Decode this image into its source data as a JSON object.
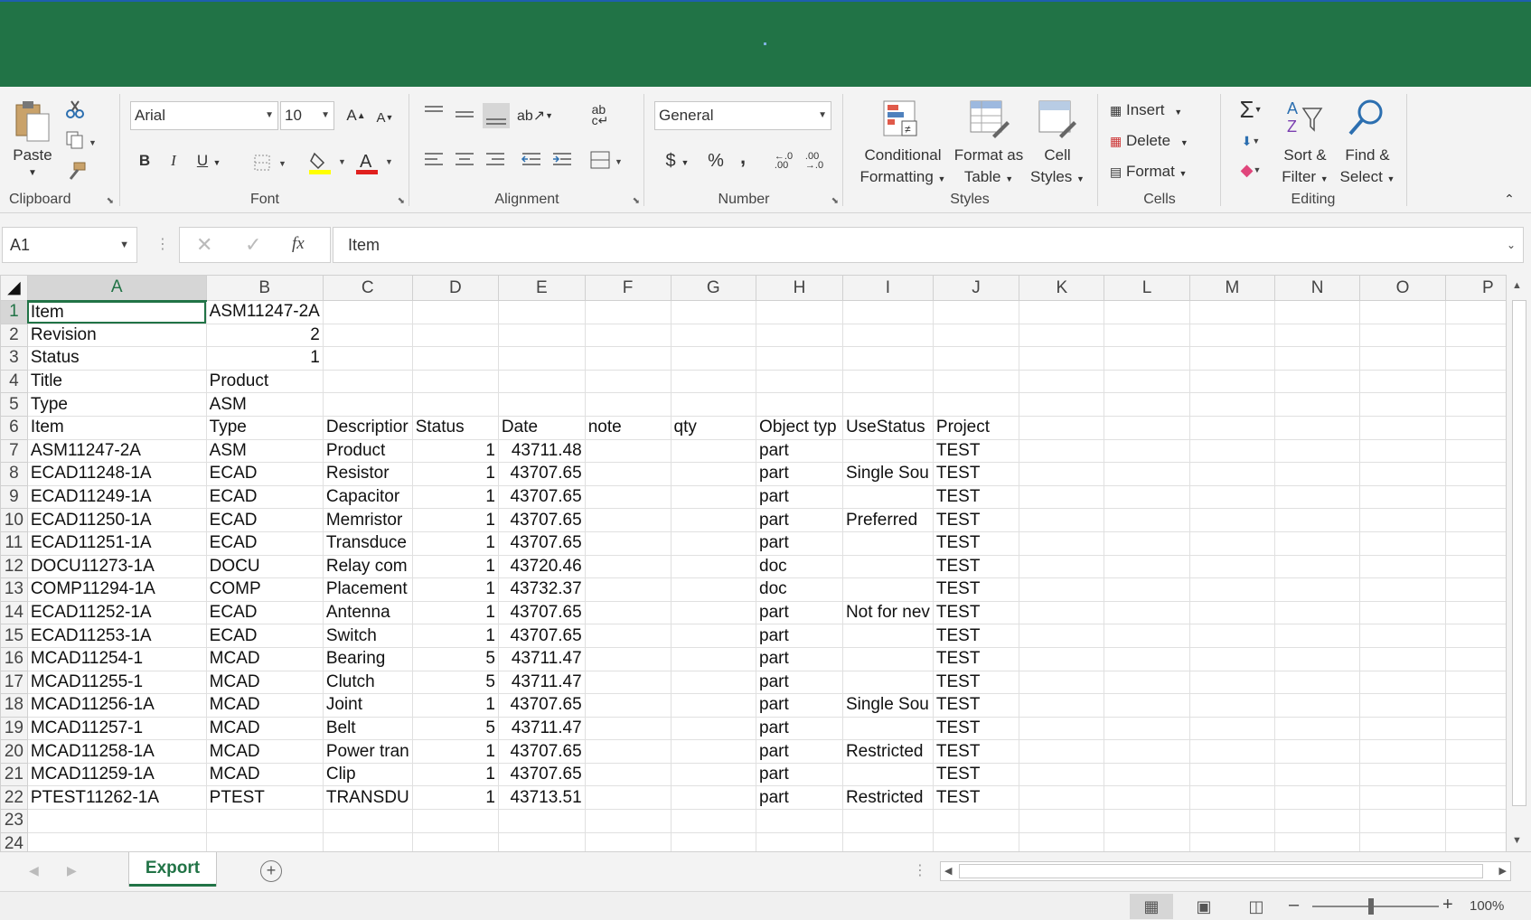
{
  "ribbon": {
    "clipboard": {
      "label": "Clipboard",
      "paste": "Paste"
    },
    "font": {
      "label": "Font",
      "font_name": "Arial",
      "font_size": "10",
      "bold": "B",
      "italic": "I",
      "underline": "U"
    },
    "alignment": {
      "label": "Alignment"
    },
    "number": {
      "label": "Number",
      "format": "General",
      "currency": "$",
      "percent": "%",
      "comma": ","
    },
    "styles": {
      "label": "Styles",
      "conditional_formatting": [
        "Conditional",
        "Formatting"
      ],
      "format_as_table": [
        "Format as",
        "Table"
      ],
      "cell_styles": [
        "Cell",
        "Styles"
      ]
    },
    "cells": {
      "label": "Cells",
      "insert": "Insert",
      "delete": "Delete",
      "format": "Format"
    },
    "editing": {
      "label": "Editing",
      "sort_filter": [
        "Sort &",
        "Filter"
      ],
      "find_select": [
        "Find &",
        "Select"
      ]
    }
  },
  "formula_bar": {
    "name_box": "A1",
    "formula": "Item",
    "fx": "fx"
  },
  "columns": [
    "A",
    "B",
    "C",
    "D",
    "E",
    "F",
    "G",
    "H",
    "I",
    "J",
    "K",
    "L",
    "M",
    "N",
    "O",
    "P"
  ],
  "rows": [
    {
      "n": "1",
      "c": [
        "Item",
        "ASM11247-2A",
        "",
        "",
        "",
        "",
        "",
        "",
        "",
        ""
      ]
    },
    {
      "n": "2",
      "c": [
        "Revision",
        "2",
        "",
        "",
        "",
        "",
        "",
        "",
        "",
        ""
      ]
    },
    {
      "n": "3",
      "c": [
        "Status",
        "1",
        "",
        "",
        "",
        "",
        "",
        "",
        "",
        ""
      ]
    },
    {
      "n": "4",
      "c": [
        "Title",
        "Product",
        "",
        "",
        "",
        "",
        "",
        "",
        "",
        ""
      ]
    },
    {
      "n": "5",
      "c": [
        "Type",
        "ASM",
        "",
        "",
        "",
        "",
        "",
        "",
        "",
        ""
      ]
    },
    {
      "n": "6",
      "c": [
        "Item",
        "Type",
        "Descriptior",
        "Status",
        "Date",
        "note",
        "qty",
        "Object typ",
        "UseStatus",
        "Project"
      ]
    },
    {
      "n": "7",
      "c": [
        "ASM11247-2A",
        "ASM",
        "Product",
        "1",
        "43711.48",
        "",
        "",
        "part",
        "",
        "TEST"
      ]
    },
    {
      "n": "8",
      "c": [
        "ECAD11248-1A",
        "ECAD",
        "Resistor",
        "1",
        "43707.65",
        "",
        "",
        "part",
        "Single Sou",
        "TEST"
      ]
    },
    {
      "n": "9",
      "c": [
        "ECAD11249-1A",
        "ECAD",
        "Capacitor",
        "1",
        "43707.65",
        "",
        "",
        "part",
        "",
        "TEST"
      ]
    },
    {
      "n": "10",
      "c": [
        "ECAD11250-1A",
        "ECAD",
        "Memristor",
        "1",
        "43707.65",
        "",
        "",
        "part",
        "Preferred",
        "TEST"
      ]
    },
    {
      "n": "11",
      "c": [
        "ECAD11251-1A",
        "ECAD",
        "Transduce",
        "1",
        "43707.65",
        "",
        "",
        "part",
        "",
        "TEST"
      ]
    },
    {
      "n": "12",
      "c": [
        "DOCU11273-1A",
        "DOCU",
        "Relay com",
        "1",
        "43720.46",
        "",
        "",
        "doc",
        "",
        "TEST"
      ]
    },
    {
      "n": "13",
      "c": [
        "COMP11294-1A",
        "COMP",
        "Placement",
        "1",
        "43732.37",
        "",
        "",
        "doc",
        "",
        "TEST"
      ]
    },
    {
      "n": "14",
      "c": [
        "ECAD11252-1A",
        "ECAD",
        "Antenna",
        "1",
        "43707.65",
        "",
        "",
        "part",
        "Not for nev",
        "TEST"
      ]
    },
    {
      "n": "15",
      "c": [
        "ECAD11253-1A",
        "ECAD",
        "Switch",
        "1",
        "43707.65",
        "",
        "",
        "part",
        "",
        "TEST"
      ]
    },
    {
      "n": "16",
      "c": [
        "MCAD11254-1",
        "MCAD",
        "Bearing",
        "5",
        "43711.47",
        "",
        "",
        "part",
        "",
        "TEST"
      ]
    },
    {
      "n": "17",
      "c": [
        "MCAD11255-1",
        "MCAD",
        "Clutch",
        "5",
        "43711.47",
        "",
        "",
        "part",
        "",
        "TEST"
      ]
    },
    {
      "n": "18",
      "c": [
        "MCAD11256-1A",
        "MCAD",
        "Joint",
        "1",
        "43707.65",
        "",
        "",
        "part",
        "Single Sou",
        "TEST"
      ]
    },
    {
      "n": "19",
      "c": [
        "MCAD11257-1",
        "MCAD",
        "Belt",
        "5",
        "43711.47",
        "",
        "",
        "part",
        "",
        "TEST"
      ]
    },
    {
      "n": "20",
      "c": [
        "MCAD11258-1A",
        "MCAD",
        "Power tran",
        "1",
        "43707.65",
        "",
        "",
        "part",
        "Restricted",
        "TEST"
      ]
    },
    {
      "n": "21",
      "c": [
        "MCAD11259-1A",
        "MCAD",
        "Clip",
        "1",
        "43707.65",
        "",
        "",
        "part",
        "",
        "TEST"
      ]
    },
    {
      "n": "22",
      "c": [
        "PTEST11262-1A",
        "PTEST",
        "TRANSDU",
        "1",
        "43713.51",
        "",
        "",
        "part",
        "Restricted",
        "TEST"
      ]
    },
    {
      "n": "23",
      "c": [
        "",
        "",
        "",
        "",
        "",
        "",
        "",
        "",
        "",
        ""
      ]
    },
    {
      "n": "24",
      "c": [
        "",
        "",
        "",
        "",
        "",
        "",
        "",
        "",
        "",
        ""
      ]
    }
  ],
  "sheet_tabs": [
    "Export"
  ],
  "status_bar": {
    "zoom": "100%"
  }
}
